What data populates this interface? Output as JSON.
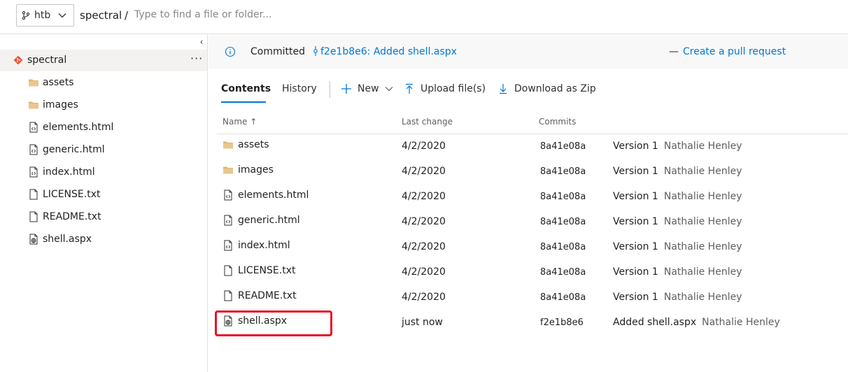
{
  "header": {
    "branch": "htb",
    "repo": "spectral",
    "separator": "/",
    "search_placeholder": "Type to find a file or folder..."
  },
  "sidebar": {
    "collapse_glyph": "‹",
    "root": {
      "label": "spectral",
      "more": "···"
    },
    "items": [
      {
        "label": "assets",
        "icon": "folder-icon"
      },
      {
        "label": "images",
        "icon": "folder-icon"
      },
      {
        "label": "elements.html",
        "icon": "code-file-icon"
      },
      {
        "label": "generic.html",
        "icon": "code-file-icon"
      },
      {
        "label": "index.html",
        "icon": "code-file-icon"
      },
      {
        "label": "LICENSE.txt",
        "icon": "text-file-icon"
      },
      {
        "label": "README.txt",
        "icon": "text-file-icon"
      },
      {
        "label": "shell.aspx",
        "icon": "web-file-icon"
      }
    ]
  },
  "banner": {
    "committed": "Committed",
    "commit_link": "f2e1b8e6: Added shell.aspx",
    "dash": "—",
    "pr_link": "Create a pull request"
  },
  "tabs": {
    "contents": "Contents",
    "history": "History"
  },
  "toolbar": {
    "new": "New",
    "upload": "Upload file(s)",
    "download": "Download as Zip"
  },
  "table": {
    "headers": {
      "name": "Name ↑",
      "last_change": "Last change",
      "commits": "Commits"
    },
    "rows": [
      {
        "name": "assets",
        "icon": "folder-icon",
        "date": "4/2/2020",
        "hash": "8a41e08a",
        "message": "Version 1",
        "author": "Nathalie Henley"
      },
      {
        "name": "images",
        "icon": "folder-icon",
        "date": "4/2/2020",
        "hash": "8a41e08a",
        "message": "Version 1",
        "author": "Nathalie Henley"
      },
      {
        "name": "elements.html",
        "icon": "code-file-icon",
        "date": "4/2/2020",
        "hash": "8a41e08a",
        "message": "Version 1",
        "author": "Nathalie Henley"
      },
      {
        "name": "generic.html",
        "icon": "code-file-icon",
        "date": "4/2/2020",
        "hash": "8a41e08a",
        "message": "Version 1",
        "author": "Nathalie Henley"
      },
      {
        "name": "index.html",
        "icon": "code-file-icon",
        "date": "4/2/2020",
        "hash": "8a41e08a",
        "message": "Version 1",
        "author": "Nathalie Henley"
      },
      {
        "name": "LICENSE.txt",
        "icon": "text-file-icon",
        "date": "4/2/2020",
        "hash": "8a41e08a",
        "message": "Version 1",
        "author": "Nathalie Henley"
      },
      {
        "name": "README.txt",
        "icon": "text-file-icon",
        "date": "4/2/2020",
        "hash": "8a41e08a",
        "message": "Version 1",
        "author": "Nathalie Henley"
      },
      {
        "name": "shell.aspx",
        "icon": "web-file-icon",
        "date": "just now",
        "hash": "f2e1b8e6",
        "message": "Added shell.aspx",
        "author": "Nathalie Henley"
      }
    ]
  },
  "colors": {
    "accent": "#0078d4",
    "git_brand": "#f05133",
    "folder": "#dcb67a",
    "highlight": "#e81123"
  }
}
